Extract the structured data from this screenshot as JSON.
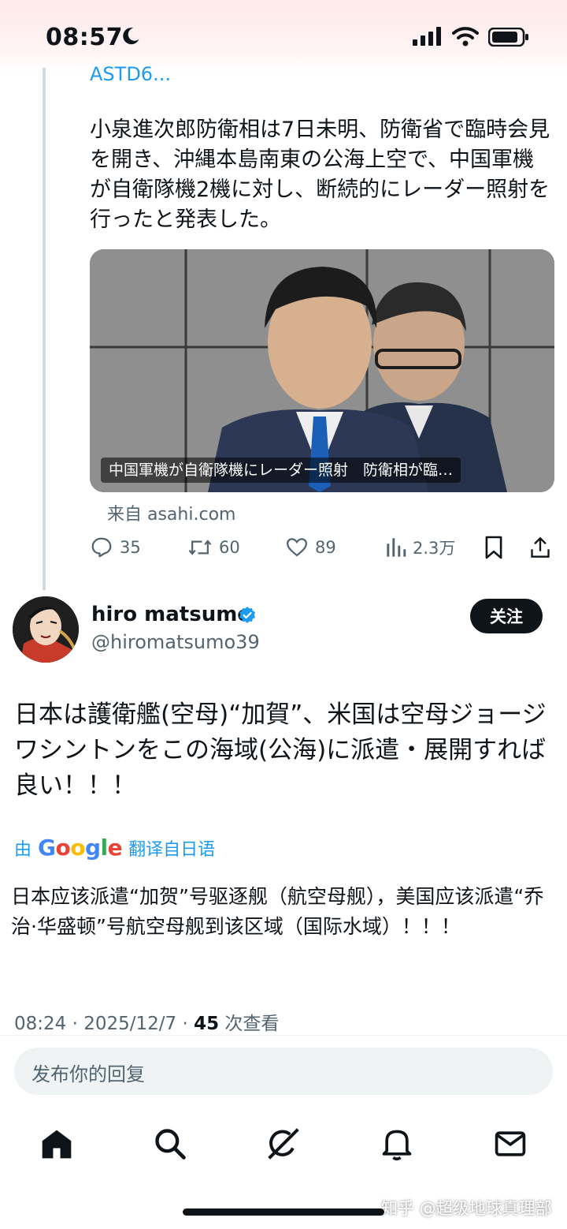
{
  "status_bar": {
    "time": "08:57",
    "icons": [
      "moon-icon",
      "signal-icon",
      "wifi-icon",
      "battery-icon"
    ]
  },
  "quoted_tweet": {
    "link_text": "ASTD6...",
    "text": "小泉進次郎防衛相は7日未明、防衛省で臨時会見を開き、沖縄本島南東の公海上空で、中国軍機が自衛隊機2機に対し、断続的にレーダー照射を行ったと発表した。",
    "card": {
      "caption": "中国軍機が自衛隊機にレーダー照射　防衛相が臨…",
      "source": "来自 asahi.com"
    },
    "actions": {
      "replies": "35",
      "reposts": "60",
      "likes": "89",
      "views": "2.3万"
    }
  },
  "tweet": {
    "display_name": "hiro matsumo",
    "handle": "@hiromatsumo39",
    "follow_label": "关注",
    "text": "日本は護衛艦(空母)“加賀”、米国は空母ジョージワシントンをこの海域(公海)に派遣・展開すれば良い！！！",
    "translation": {
      "prefix": "由",
      "provider": "Google",
      "suffix": "翻译自日语",
      "text": "日本应该派遣“加贺”号驱逐舰（航空母舰），美国应该派遣“乔治·华盛顿”号航空母舰到该区域（国际水域）！！！"
    },
    "meta": {
      "time_date": "08:24 · 2025/12/7 · ",
      "views": "45",
      "views_label": " 次查看"
    }
  },
  "reply": {
    "placeholder": "发布你的回复"
  },
  "bottom_nav": [
    "home-icon",
    "search-icon",
    "grok-icon",
    "notifications-icon",
    "messages-icon"
  ],
  "watermark": "知乎 @超级地球真理部",
  "colors": {
    "accent": "#1d9bf0",
    "text": "#0f1419",
    "muted": "#536471",
    "follow_bg": "#0f1419"
  }
}
